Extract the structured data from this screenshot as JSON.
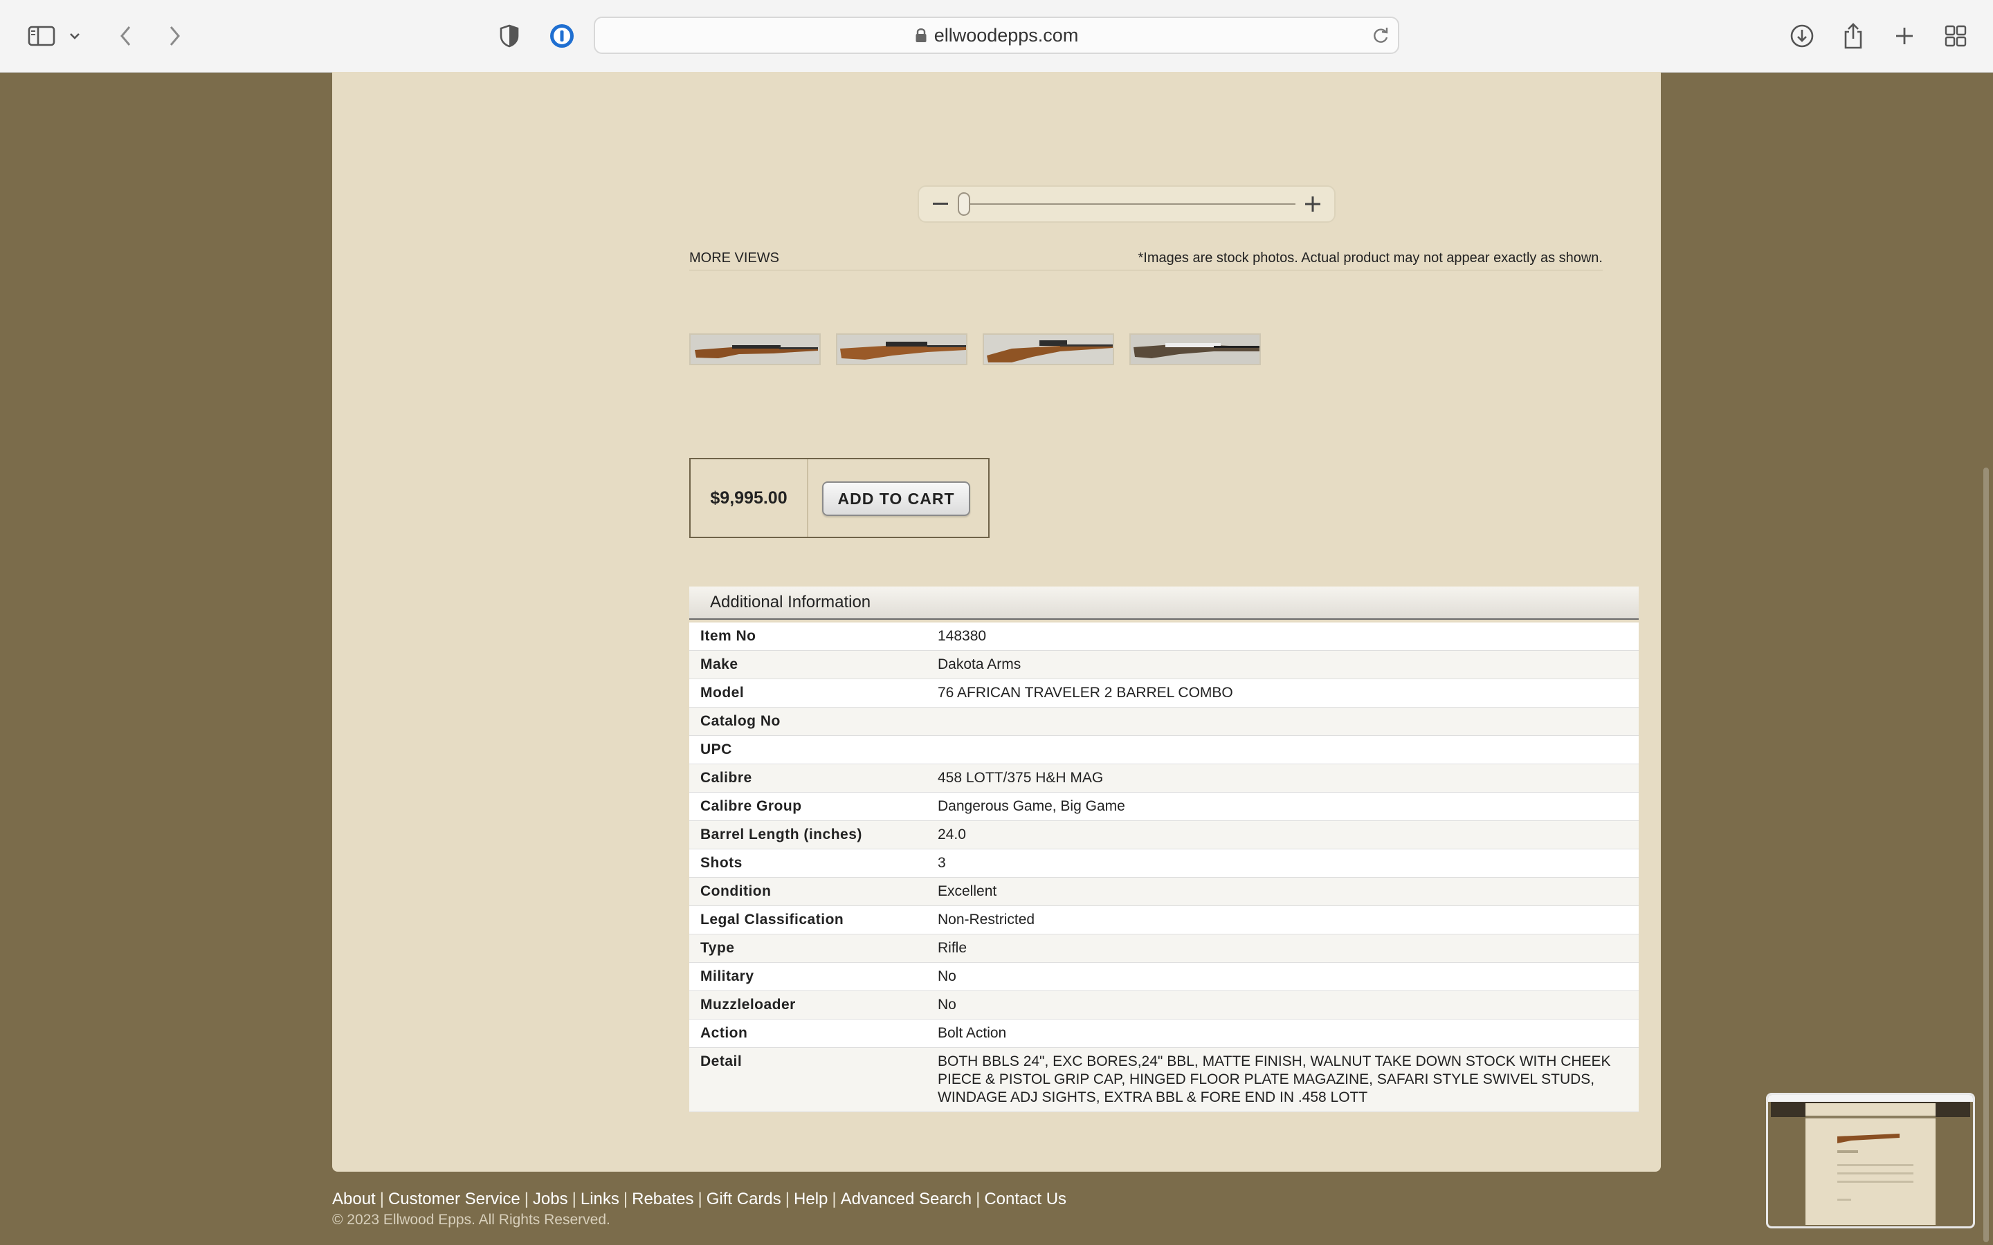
{
  "browser": {
    "url": "ellwoodepps.com"
  },
  "product": {
    "more_views_label": "MORE VIEWS",
    "stock_note": "*Images are stock photos. Actual product may not appear exactly as shown.",
    "price": "$9,995.00",
    "add_to_cart_label": "ADD TO CART",
    "zoom_level": 0.0
  },
  "additional_info": {
    "heading": "Additional Information",
    "rows": [
      {
        "label": "Item No",
        "value": "148380"
      },
      {
        "label": "Make",
        "value": "Dakota Arms"
      },
      {
        "label": "Model",
        "value": "76 AFRICAN TRAVELER 2 BARREL COMBO"
      },
      {
        "label": "Catalog No",
        "value": ""
      },
      {
        "label": "UPC",
        "value": ""
      },
      {
        "label": "Calibre",
        "value": "458 LOTT/375 H&H MAG"
      },
      {
        "label": "Calibre Group",
        "value": "Dangerous Game, Big Game"
      },
      {
        "label": "Barrel Length (inches)",
        "value": "24.0"
      },
      {
        "label": "Shots",
        "value": "3"
      },
      {
        "label": "Condition",
        "value": "Excellent"
      },
      {
        "label": "Legal Classification",
        "value": "Non-Restricted"
      },
      {
        "label": "Type",
        "value": "Rifle"
      },
      {
        "label": "Military",
        "value": "No"
      },
      {
        "label": "Muzzleloader",
        "value": "No"
      },
      {
        "label": "Action",
        "value": "Bolt Action"
      },
      {
        "label": "Detail",
        "value": "BOTH BBLS 24\", EXC BORES,24\" BBL, MATTE FINISH, WALNUT TAKE DOWN STOCK WITH CHEEK PIECE & PISTOL GRIP CAP, HINGED FLOOR PLATE MAGAZINE, SAFARI STYLE SWIVEL STUDS, WINDAGE ADJ SIGHTS, EXTRA BBL & FORE END IN .458 LOTT"
      }
    ]
  },
  "footer": {
    "links": [
      "About",
      "Customer Service",
      "Jobs",
      "Links",
      "Rebates",
      "Gift Cards",
      "Help",
      "Advanced Search",
      "Contact Us"
    ],
    "copyright": "© 2023 Ellwood Epps. All Rights Reserved."
  },
  "icons": {
    "sidebar": "sidebar-icon",
    "back": "chevron-left-icon",
    "forward": "chevron-right-icon",
    "privacy": "shield-icon",
    "password": "password-manager-icon",
    "lock": "lock-icon",
    "reload": "reload-icon",
    "download": "download-icon",
    "share": "share-icon",
    "new_tab": "plus-icon",
    "tabs": "tab-overview-icon"
  },
  "colors": {
    "page_background": "#7b6c4b",
    "panel_background": "#e6dcc4"
  }
}
